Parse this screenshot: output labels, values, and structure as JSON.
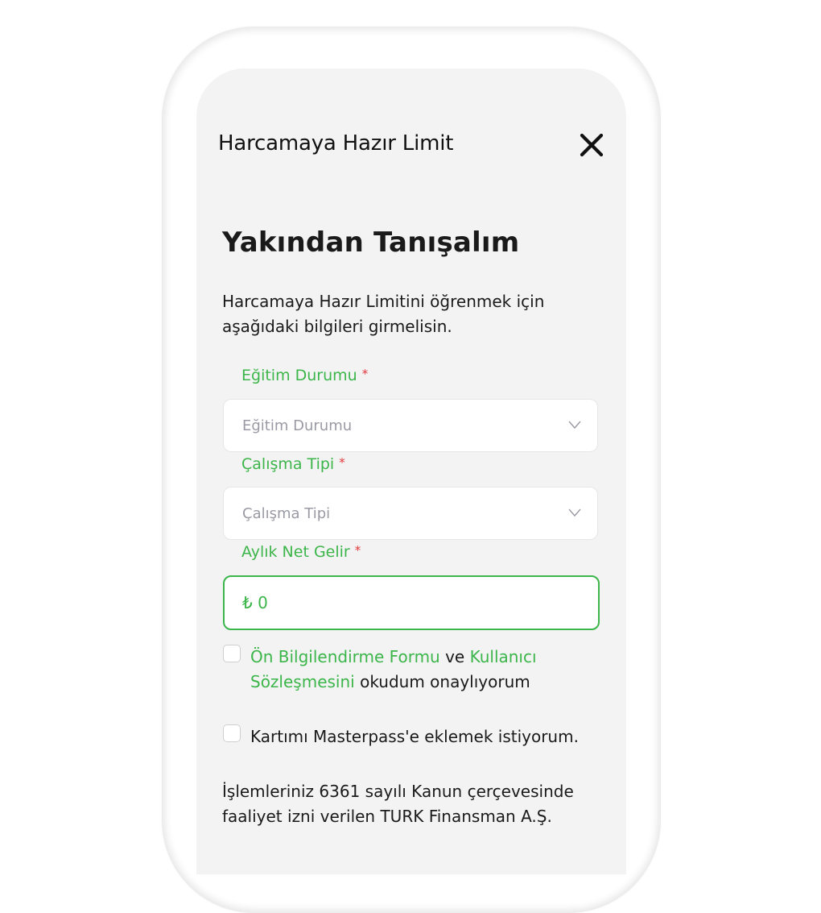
{
  "header": {
    "title": "Harcamaya Hazır Limit",
    "close_icon": "close-icon"
  },
  "page": {
    "title": "Yakından Tanışalım",
    "intro": "Harcamaya Hazır Limitini öğrenmek için aşağıdaki bilgileri girmelisin."
  },
  "form": {
    "education": {
      "label": "Eğitim Durumu",
      "required_mark": "*",
      "placeholder": "Eğitim Durumu",
      "icon": "chevron-down-icon"
    },
    "employment": {
      "label": "Çalışma Tipi",
      "required_mark": "*",
      "placeholder": "Çalışma Tipi",
      "icon": "chevron-down-icon"
    },
    "income": {
      "label": "Aylık Net Gelir",
      "required_mark": "*",
      "value": "₺ 0"
    }
  },
  "consents": {
    "terms": {
      "link1": "Ön Bilgilendirme Formu",
      "joiner": " ve ",
      "link2": "Kullanıcı Sözleşmesini",
      "suffix": " okudum onaylıyorum",
      "checked": false
    },
    "masterpass": {
      "text": "Kartımı Masterpass'e eklemek istiyorum.",
      "checked": false
    }
  },
  "footer": {
    "text": "İşlemleriniz 6361 sayılı Kanun çerçevesinde faaliyet izni verilen TURK Finansman A.Ş."
  },
  "colors": {
    "accent": "#3cb54a",
    "required": "#e2383b",
    "background": "#f3f3f3"
  }
}
